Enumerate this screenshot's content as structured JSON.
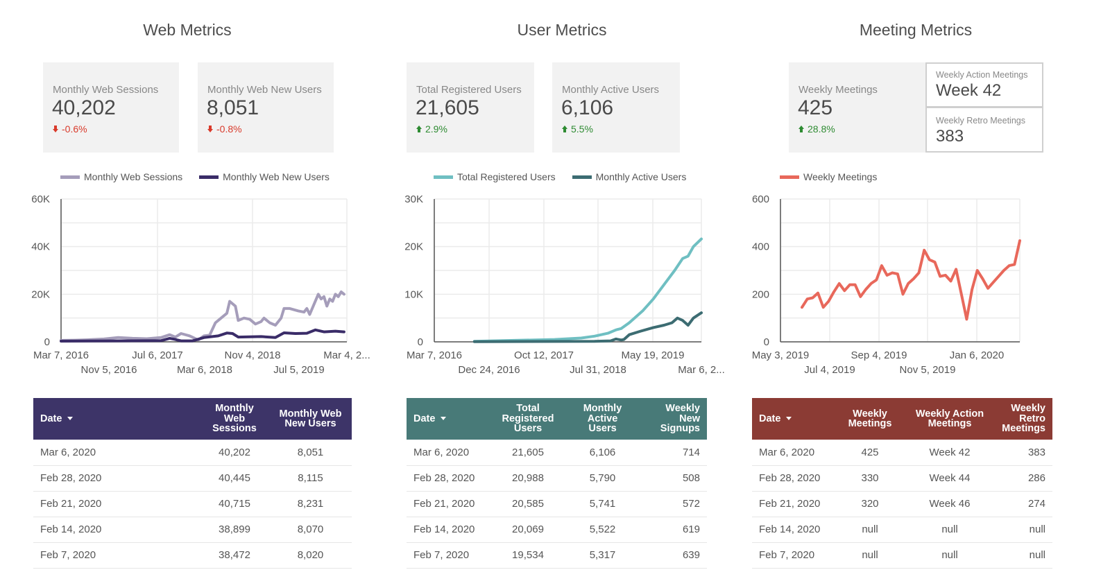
{
  "sections": {
    "web": {
      "title": "Web Metrics",
      "kpis": [
        {
          "label": "Monthly Web Sessions",
          "value": "40,202",
          "delta": "-0.6%",
          "direction": "down"
        },
        {
          "label": "Monthly Web New Users",
          "value": "8,051",
          "delta": "-0.8%",
          "direction": "down"
        }
      ],
      "table": {
        "header_color": "#3d3468",
        "columns": [
          "Date",
          "Monthly Web Sessions",
          "Monthly Web New Users"
        ],
        "rows": [
          [
            "Mar 6, 2020",
            "40,202",
            "8,051"
          ],
          [
            "Feb 28, 2020",
            "40,445",
            "8,115"
          ],
          [
            "Feb 21, 2020",
            "40,715",
            "8,231"
          ],
          [
            "Feb 14, 2020",
            "38,899",
            "8,070"
          ],
          [
            "Feb 7, 2020",
            "38,472",
            "8,020"
          ]
        ]
      }
    },
    "user": {
      "title": "User Metrics",
      "kpis": [
        {
          "label": "Total Registered Users",
          "value": "21,605",
          "delta": "2.9%",
          "direction": "up"
        },
        {
          "label": "Monthly Active Users",
          "value": "6,106",
          "delta": "5.5%",
          "direction": "up"
        }
      ],
      "table": {
        "header_color": "#487a78",
        "columns": [
          "Date",
          "Total Registered Users",
          "Monthly Active Users",
          "Weekly New Signups"
        ],
        "rows": [
          [
            "Mar 6, 2020",
            "21,605",
            "6,106",
            "714"
          ],
          [
            "Feb 28, 2020",
            "20,988",
            "5,790",
            "508"
          ],
          [
            "Feb 21, 2020",
            "20,585",
            "5,741",
            "572"
          ],
          [
            "Feb 14, 2020",
            "20,069",
            "5,522",
            "619"
          ],
          [
            "Feb 7, 2020",
            "19,534",
            "5,317",
            "639"
          ]
        ]
      }
    },
    "meeting": {
      "title": "Meeting Metrics",
      "kpis": [
        {
          "label": "Weekly Meetings",
          "value": "425",
          "delta": "28.8%",
          "direction": "up"
        }
      ],
      "kpi_boxes": [
        {
          "label": "Weekly Action Meetings",
          "value": "Week 42"
        },
        {
          "label": "Weekly Retro Meetings",
          "value": "383"
        }
      ],
      "table": {
        "header_color": "#8b3b34",
        "columns": [
          "Date",
          "Weekly Meetings",
          "Weekly Action Meetings",
          "Weekly Retro Meetings"
        ],
        "rows": [
          [
            "Mar 6, 2020",
            "425",
            "Week 42",
            "383"
          ],
          [
            "Feb 28, 2020",
            "330",
            "Week 44",
            "286"
          ],
          [
            "Feb 21, 2020",
            "320",
            "Week 46",
            "274"
          ],
          [
            "Feb 14, 2020",
            "null",
            "null",
            "null"
          ],
          [
            "Feb 7, 2020",
            "null",
            "null",
            "null"
          ]
        ]
      }
    }
  },
  "colors": {
    "down": "#d93a2b",
    "up": "#2e8b32",
    "kpi_bg": "#f2f2f2"
  },
  "chart_data": [
    {
      "type": "line",
      "title": "",
      "xlabel": "",
      "ylabel": "",
      "ylim": [
        0,
        60000
      ],
      "yticks": [
        "0",
        "20K",
        "40K",
        "60K"
      ],
      "xticks_row1": [
        "Mar 7, 2016",
        "Jul 6, 2017",
        "Nov 4, 2018",
        "Mar 4, 2..."
      ],
      "xticks_row2": [
        "Nov 5, 2016",
        "Mar 6, 2018",
        "Jul 5, 2019"
      ],
      "x_range_fraction": [
        0,
        1
      ],
      "legend": "top",
      "grid": true,
      "series": [
        {
          "name": "Monthly Web Sessions",
          "color": "#a59dba",
          "points": [
            [
              0,
              600
            ],
            [
              0.05,
              700
            ],
            [
              0.1,
              900
            ],
            [
              0.15,
              1200
            ],
            [
              0.2,
              1800
            ],
            [
              0.25,
              1500
            ],
            [
              0.3,
              1300
            ],
            [
              0.35,
              1800
            ],
            [
              0.38,
              3000
            ],
            [
              0.4,
              2000
            ],
            [
              0.42,
              3500
            ],
            [
              0.45,
              2500
            ],
            [
              0.48,
              800
            ],
            [
              0.5,
              2500
            ],
            [
              0.52,
              2800
            ],
            [
              0.54,
              8000
            ],
            [
              0.56,
              10000
            ],
            [
              0.58,
              12000
            ],
            [
              0.59,
              17000
            ],
            [
              0.61,
              15000
            ],
            [
              0.62,
              9000
            ],
            [
              0.64,
              10000
            ],
            [
              0.66,
              9500
            ],
            [
              0.68,
              7500
            ],
            [
              0.7,
              8500
            ],
            [
              0.71,
              10000
            ],
            [
              0.73,
              8000
            ],
            [
              0.75,
              7000
            ],
            [
              0.77,
              10000
            ],
            [
              0.78,
              14000
            ],
            [
              0.8,
              14000
            ],
            [
              0.83,
              13000
            ],
            [
              0.85,
              12500
            ],
            [
              0.86,
              14000
            ],
            [
              0.87,
              11500
            ],
            [
              0.9,
              20000
            ],
            [
              0.91,
              18000
            ],
            [
              0.92,
              19000
            ],
            [
              0.93,
              15000
            ],
            [
              0.94,
              18000
            ],
            [
              0.95,
              17000
            ],
            [
              0.96,
              20000
            ],
            [
              0.97,
              19000
            ],
            [
              0.98,
              21000
            ],
            [
              0.99,
              20000
            ]
          ],
          "note": "points as [x-fraction of axis, value]"
        },
        {
          "name": "Monthly Web New Users",
          "color": "#3a2c68",
          "points": [
            [
              0,
              300
            ],
            [
              0.2,
              400
            ],
            [
              0.35,
              500
            ],
            [
              0.38,
              1500
            ],
            [
              0.4,
              1000
            ],
            [
              0.42,
              400
            ],
            [
              0.46,
              400
            ],
            [
              0.5,
              1800
            ],
            [
              0.55,
              2500
            ],
            [
              0.58,
              3700
            ],
            [
              0.6,
              3500
            ],
            [
              0.62,
              2000
            ],
            [
              0.7,
              2200
            ],
            [
              0.75,
              1800
            ],
            [
              0.78,
              3800
            ],
            [
              0.82,
              3500
            ],
            [
              0.86,
              3600
            ],
            [
              0.89,
              5000
            ],
            [
              0.92,
              4200
            ],
            [
              0.96,
              4500
            ],
            [
              0.99,
              4200
            ]
          ]
        }
      ]
    },
    {
      "type": "line",
      "ylim": [
        0,
        30000
      ],
      "yticks": [
        "0",
        "10K",
        "20K",
        "30K"
      ],
      "xticks_row1": [
        "Mar 7, 2016",
        "Oct 12, 2017",
        "May 19, 2019"
      ],
      "xticks_row2": [
        "Dec 24, 2016",
        "Jul 31, 2018",
        "Mar 6, 2..."
      ],
      "legend": "top",
      "grid": true,
      "series": [
        {
          "name": "Total Registered Users",
          "color": "#6fbfc2",
          "points": [
            [
              0.15,
              100
            ],
            [
              0.3,
              300
            ],
            [
              0.45,
              500
            ],
            [
              0.55,
              800
            ],
            [
              0.6,
              1200
            ],
            [
              0.65,
              1800
            ],
            [
              0.68,
              2500
            ],
            [
              0.7,
              2800
            ],
            [
              0.73,
              4000
            ],
            [
              0.78,
              6500
            ],
            [
              0.82,
              9000
            ],
            [
              0.86,
              12000
            ],
            [
              0.9,
              15000
            ],
            [
              0.93,
              17500
            ],
            [
              0.95,
              18000
            ],
            [
              0.97,
              20000
            ],
            [
              1.0,
              21605
            ]
          ]
        },
        {
          "name": "Monthly Active Users",
          "color": "#3c6c72",
          "points": [
            [
              0.15,
              50
            ],
            [
              0.6,
              100
            ],
            [
              0.66,
              200
            ],
            [
              0.68,
              600
            ],
            [
              0.7,
              400
            ],
            [
              0.71,
              500
            ],
            [
              0.73,
              1500
            ],
            [
              0.77,
              2200
            ],
            [
              0.82,
              3000
            ],
            [
              0.86,
              3500
            ],
            [
              0.89,
              4000
            ],
            [
              0.91,
              5000
            ],
            [
              0.93,
              4500
            ],
            [
              0.95,
              3500
            ],
            [
              0.97,
              5000
            ],
            [
              1.0,
              6106
            ]
          ]
        }
      ]
    },
    {
      "type": "line",
      "ylim": [
        0,
        600
      ],
      "yticks": [
        "0",
        "200",
        "400",
        "600"
      ],
      "xticks_row1": [
        "May 3, 2019",
        "Sep 4, 2019",
        "Jan 6, 2020"
      ],
      "xticks_row2": [
        "Jul 4, 2019",
        "Nov 5, 2019"
      ],
      "legend": "top",
      "grid": true,
      "series": [
        {
          "name": "Weekly Meetings",
          "color": "#e8685b",
          "values": [
            145,
            180,
            185,
            205,
            145,
            170,
            210,
            245,
            215,
            240,
            240,
            190,
            220,
            245,
            260,
            320,
            280,
            290,
            285,
            200,
            245,
            265,
            290,
            385,
            345,
            335,
            275,
            280,
            255,
            305,
            200,
            95,
            220,
            300,
            265,
            225,
            250,
            275,
            300,
            320,
            325,
            425
          ]
        }
      ]
    }
  ]
}
